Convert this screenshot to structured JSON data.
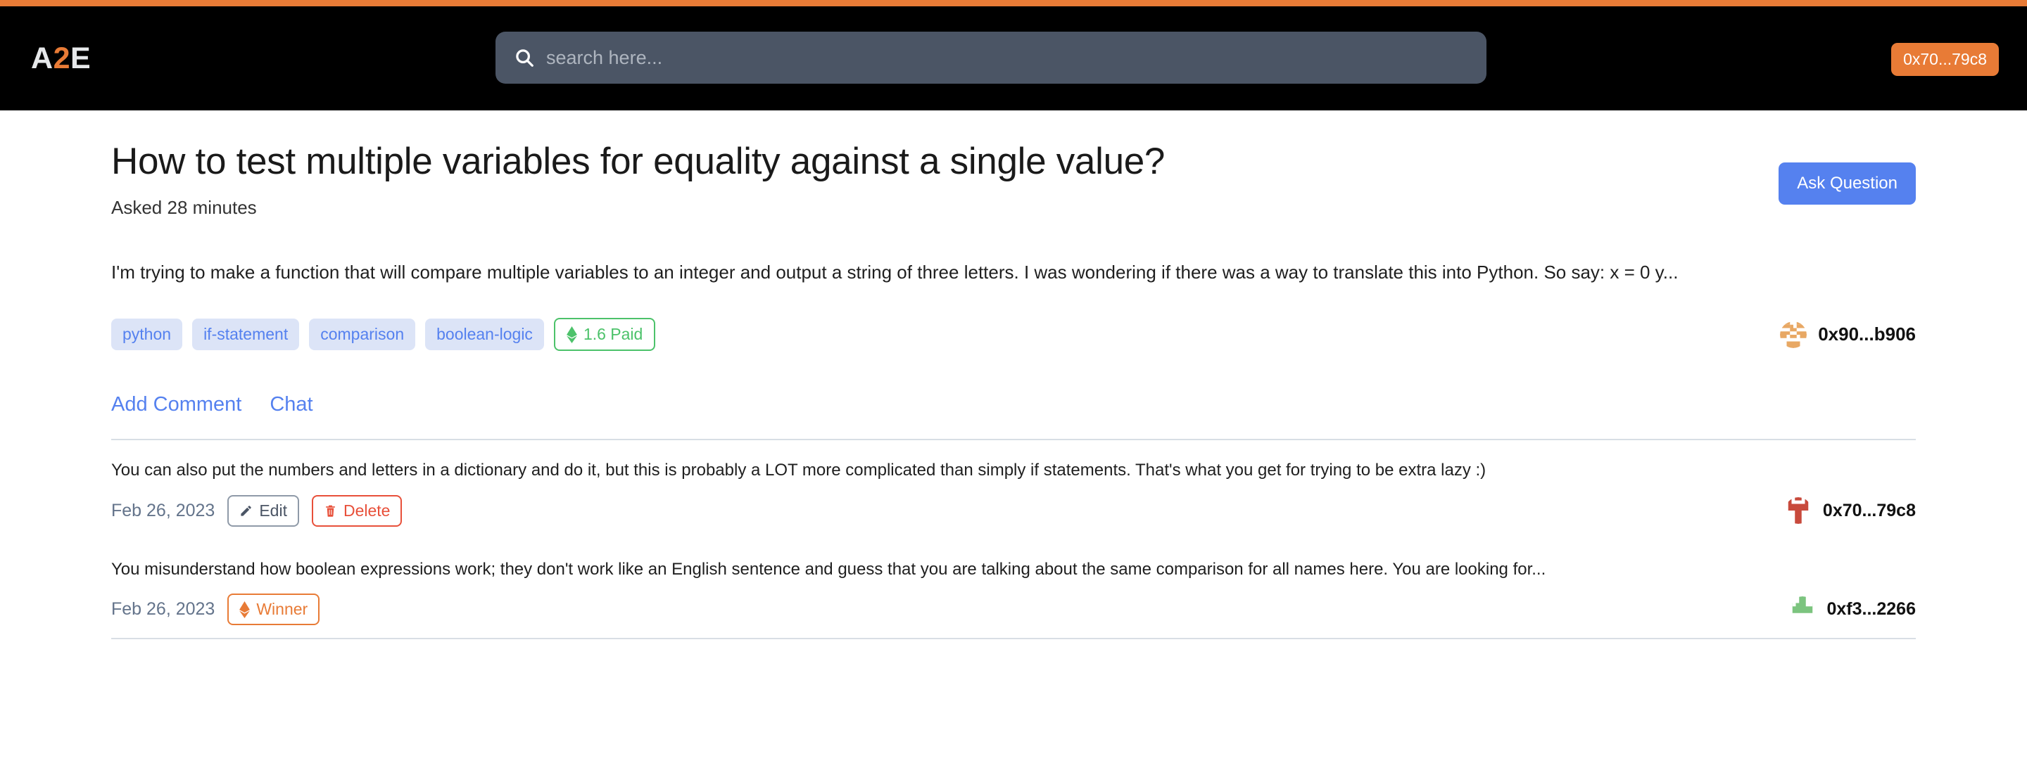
{
  "brand": {
    "logo_left": "A",
    "logo_mid": "2",
    "logo_right": "E",
    "accent_color": "#e87b36"
  },
  "header": {
    "search": {
      "value": "",
      "placeholder": "search here...",
      "icon": "search-icon"
    },
    "wallet_button": {
      "label": "0x70...79c8",
      "color": "#e87b36"
    }
  },
  "question": {
    "title": "How to test multiple variables for equality against a single value?",
    "asked": "Asked 28 minutes",
    "body": "I'm trying to make a function that will compare multiple variables to an integer and output a string of three letters. I was wondering if there was a way to translate this into Python. So say: x = 0 y...",
    "ask_button_label": "Ask Question",
    "ask_button_color": "#5581ef",
    "tags": [
      "python",
      "if-statement",
      "comparison",
      "boolean-logic"
    ],
    "paid_badge": {
      "label": "1.6 Paid",
      "icon": "ethereum-icon",
      "color": "#4cc26a"
    },
    "owner": {
      "address": "0x90...b906",
      "avatar": "blockie-avatar-orange"
    }
  },
  "actions": {
    "add_comment": "Add Comment",
    "chat": "Chat"
  },
  "comments": [
    {
      "text": "You can also put the numbers and letters in a dictionary and do it, but this is probably a LOT more complicated than simply if statements. That's what you get for trying to be extra lazy :)",
      "date": "Feb 26, 2023",
      "buttons": [
        {
          "label": "Edit",
          "icon": "pencil-icon",
          "style": "edit"
        },
        {
          "label": "Delete",
          "icon": "trash-icon",
          "style": "delete"
        }
      ],
      "address": "0x70...79c8",
      "avatar": "blockie-avatar-red"
    },
    {
      "text": "You misunderstand how boolean expressions work; they don't work like an English sentence and guess that you are talking about the same comparison for all names here. You are looking for...",
      "date": "Feb 26, 2023",
      "buttons": [
        {
          "label": "Winner",
          "icon": "ethereum-icon",
          "style": "winner"
        }
      ],
      "address": "0xf3...2266",
      "avatar": "blockie-avatar-green"
    }
  ]
}
